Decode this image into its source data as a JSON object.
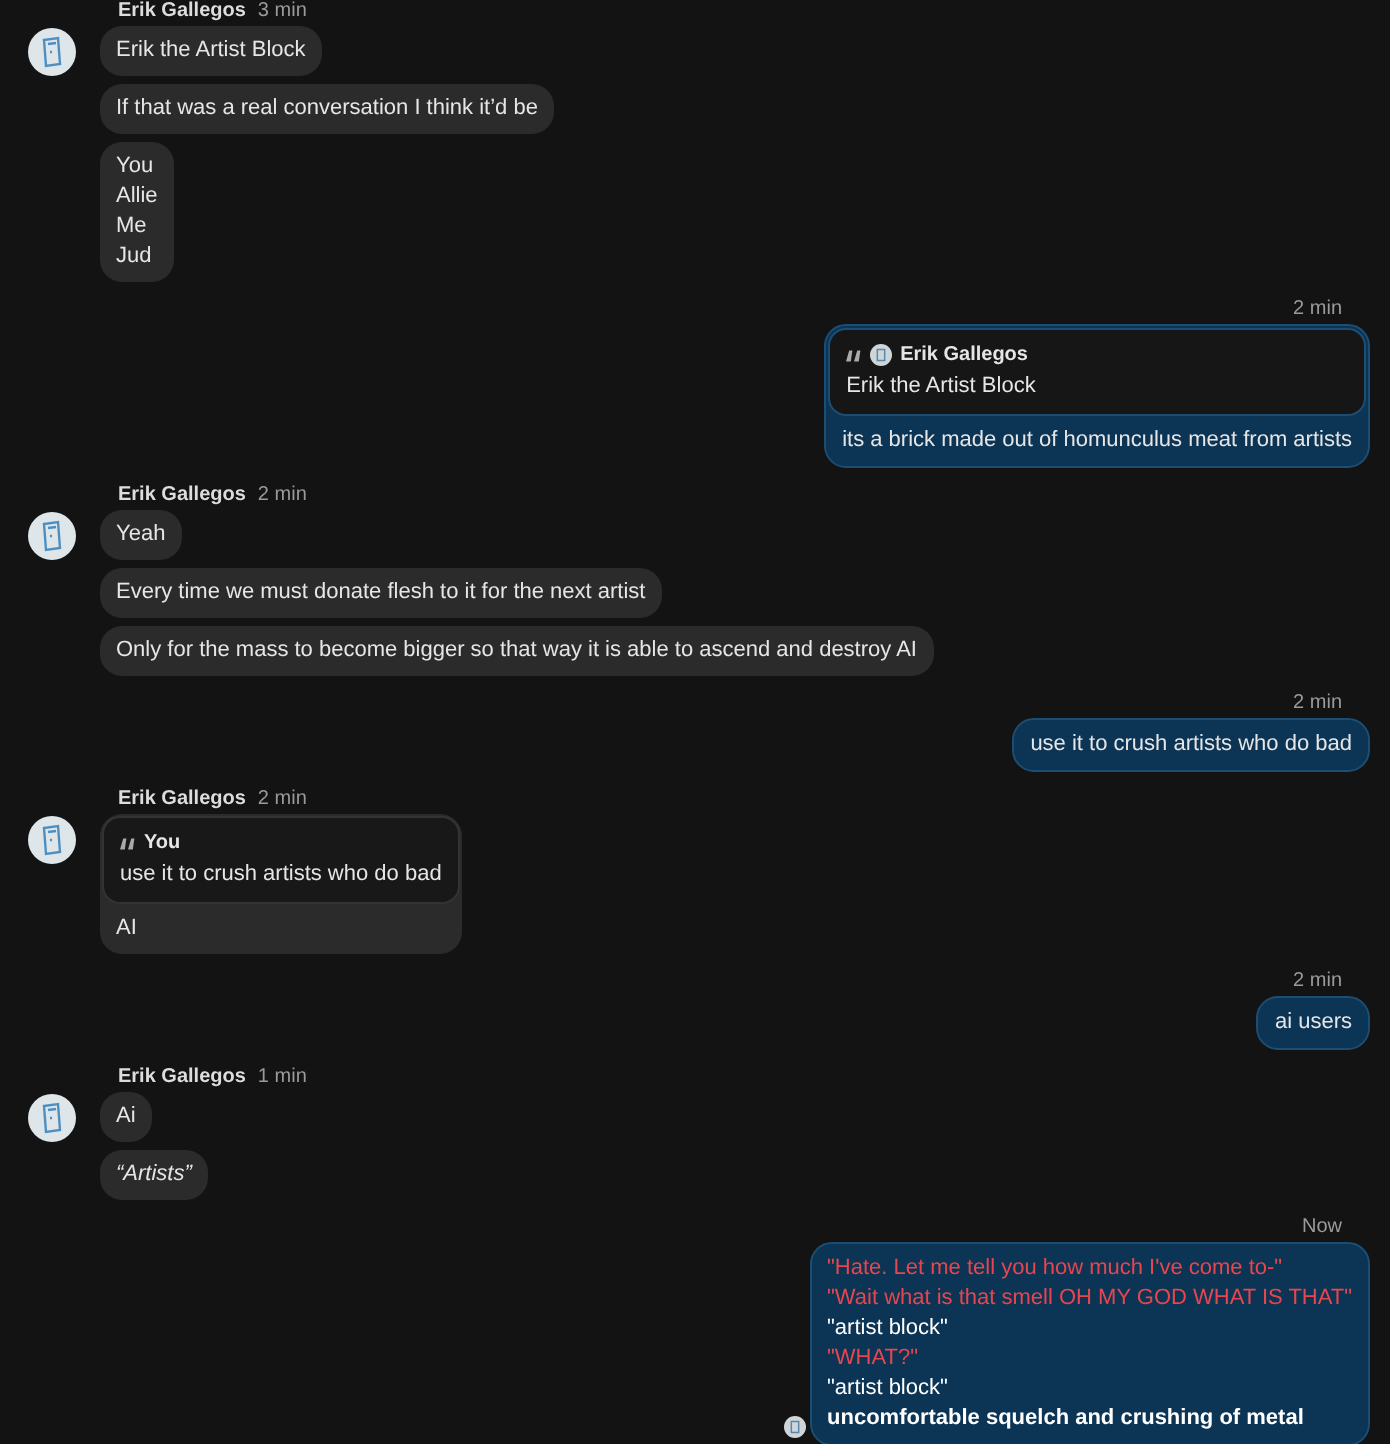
{
  "groups": [
    {
      "kind": "incoming",
      "sender": "Erik Gallegos",
      "time": "3 min",
      "messages": [
        {
          "kind": "text",
          "lines": [
            {
              "text": "Erik the Artist Block"
            }
          ]
        },
        {
          "kind": "text",
          "lines": [
            {
              "text": "If that was a real conversation I think it’d be"
            }
          ]
        },
        {
          "kind": "text",
          "lines": [
            {
              "text": "You"
            },
            {
              "text": "Allie"
            },
            {
              "text": "Me"
            },
            {
              "text": "Jud"
            }
          ]
        }
      ]
    },
    {
      "kind": "outgoing",
      "time": "2 min",
      "messages": [
        {
          "kind": "quote",
          "quote": {
            "author": "Erik Gallegos",
            "avatar": true,
            "text": "Erik the Artist Block"
          },
          "lines": [
            {
              "text": "its a brick made out of homunculus meat from artists"
            }
          ]
        }
      ]
    },
    {
      "kind": "incoming",
      "sender": "Erik Gallegos",
      "time": "2 min",
      "messages": [
        {
          "kind": "text",
          "lines": [
            {
              "text": "Yeah"
            }
          ]
        },
        {
          "kind": "text",
          "lines": [
            {
              "text": "Every time we must donate flesh to it for the next artist"
            }
          ]
        },
        {
          "kind": "text",
          "lines": [
            {
              "text": "Only for the mass to become bigger so that way it is able to ascend and destroy AI"
            }
          ]
        }
      ]
    },
    {
      "kind": "outgoing",
      "time": "2 min",
      "messages": [
        {
          "kind": "text",
          "lines": [
            {
              "text": "use it to crush artists who do bad"
            }
          ]
        }
      ]
    },
    {
      "kind": "incoming",
      "sender": "Erik Gallegos",
      "time": "2 min",
      "messages": [
        {
          "kind": "quote",
          "quote": {
            "author": "You",
            "avatar": false,
            "text": "use it to crush artists who do bad"
          },
          "lines": [
            {
              "text": "AI"
            }
          ]
        }
      ]
    },
    {
      "kind": "outgoing",
      "time": "2 min",
      "messages": [
        {
          "kind": "text",
          "lines": [
            {
              "text": "ai users"
            }
          ]
        }
      ]
    },
    {
      "kind": "incoming",
      "sender": "Erik Gallegos",
      "time": "1 min",
      "messages": [
        {
          "kind": "text",
          "lines": [
            {
              "text": "Ai"
            }
          ]
        },
        {
          "kind": "text",
          "italic": true,
          "lines": [
            {
              "text": "“Artists”"
            }
          ]
        }
      ]
    },
    {
      "kind": "outgoing",
      "time": "Now",
      "read_receipt": true,
      "messages": [
        {
          "kind": "text",
          "lines": [
            {
              "text": "\"Hate. Let me tell you how much I've come to-\"",
              "color": "#e8464f"
            },
            {
              "text": "\"Wait what is that smell OH MY GOD WHAT IS THAT\"",
              "color": "#e8464f"
            },
            {
              "text": "\"artist block\"",
              "color": "#ffffff"
            },
            {
              "text": "\"WHAT?\"",
              "color": "#e8464f"
            },
            {
              "text": "\"artist block\"",
              "color": "#ffffff"
            },
            {
              "text": "uncomfortable squelch and crushing of metal",
              "color": "#ffffff",
              "bold": true
            }
          ]
        }
      ]
    }
  ]
}
